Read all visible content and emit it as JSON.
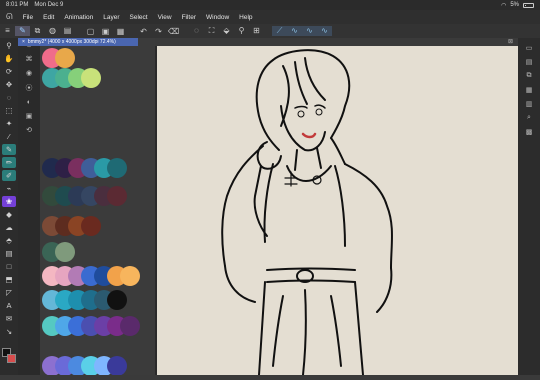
{
  "status_bar": {
    "time": "8:01 PM",
    "date": "Mon Dec 9",
    "battery_pct": "5%"
  },
  "menu": {
    "items": [
      "File",
      "Edit",
      "Animation",
      "Layer",
      "Select",
      "View",
      "Filter",
      "Window",
      "Help"
    ]
  },
  "document": {
    "tab_label": "bmmy2* (4000 x 4000px 300dpi 72.4%)"
  },
  "colors": {
    "accent": "#2b7d7a",
    "tab_blue": "#4a66b0",
    "main_color": "#111111",
    "sub_color": "#d84d4d",
    "canvas_bg": "#e4ded2"
  },
  "tools": {
    "left": [
      "menu-icon",
      "zoom-icon",
      "hand-icon",
      "rotate-icon",
      "move-icon",
      "lasso-icon",
      "select-icon",
      "wand-icon",
      "eyedropper-icon",
      "pen-icon",
      "pencil-icon",
      "brush-icon",
      "airbrush-icon",
      "decoration-icon",
      "eraser-icon",
      "blend-icon",
      "fill-icon",
      "gradient-icon",
      "figure-icon",
      "frame-icon",
      "ruler-icon",
      "text-icon",
      "balloon-icon",
      "correct-line-icon"
    ]
  },
  "palette_rows": [
    [
      "#f06c8a",
      "#e8a84a"
    ],
    [
      "#3ea6a3",
      "#4bb08f",
      "#86d07a",
      "#c8e27a"
    ],
    [
      "#202a4d",
      "#2e2046",
      "#7a2f5f",
      "#3f5e99",
      "#2a9aa6",
      "#1f6a74"
    ],
    [
      "#324a3c",
      "#1f4b4f",
      "#2c3a56",
      "#354662",
      "#4a2e3e",
      "#5b2a33"
    ],
    [
      "#7c4a36",
      "#5d2c1f",
      "#8a4424",
      "#6a2a1f"
    ],
    [
      "#3a6455",
      "#7f9a7c"
    ],
    [
      "#f4b7c2",
      "#e6a5c0",
      "#b27bb5",
      "#3a6bd0",
      "#1f4c9c",
      "#f2a24a",
      "#f7b55d"
    ],
    [
      "#64b7d7",
      "#2aa8c4",
      "#1e8fae",
      "#1f6e8c",
      "#2b5a70",
      "#111111"
    ],
    [
      "#55c9c2",
      "#4fa7e8",
      "#3b6fd8",
      "#4b4fb0",
      "#6b3fa6",
      "#7a2c8a",
      "#5a2a6b"
    ],
    [
      "#8c70d0",
      "#6a6ad8",
      "#4c8ae0",
      "#5ad0e8",
      "#7fb6ff",
      "#3a3a9a"
    ]
  ]
}
